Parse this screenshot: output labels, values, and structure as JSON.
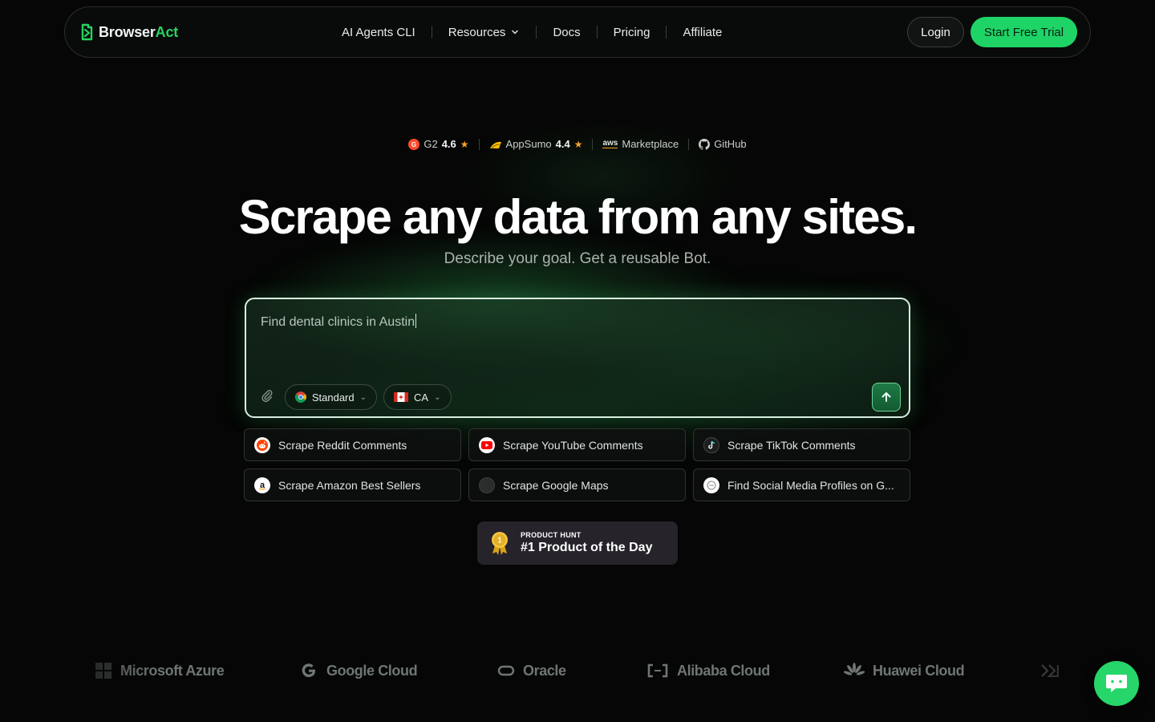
{
  "nav": {
    "logo_part1": "Browser",
    "logo_part2": "Act",
    "items": [
      {
        "label": "AI Agents CLI"
      },
      {
        "label": "Resources"
      },
      {
        "label": "Docs"
      },
      {
        "label": "Pricing"
      },
      {
        "label": "Affiliate"
      }
    ],
    "login_label": "Login",
    "trial_label": "Start Free Trial"
  },
  "ratings": {
    "g2_label": "G2",
    "g2_score": "4.6",
    "appsumo_label": "AppSumo",
    "appsumo_score": "4.4",
    "aws_label": "Marketplace",
    "aws_mark": "aws",
    "github_label": "GitHub"
  },
  "hero": {
    "title": "Scrape any data from any sites.",
    "subtitle": "Describe your goal. Get a reusable Bot."
  },
  "prompt": {
    "value": "Find dental clinics in Austin",
    "mode_label": "Standard",
    "region_label": "CA"
  },
  "suggestions": [
    {
      "label": "Scrape Reddit Comments",
      "icon": "reddit-icon"
    },
    {
      "label": "Scrape YouTube Comments",
      "icon": "youtube-icon"
    },
    {
      "label": "Scrape TikTok Comments",
      "icon": "tiktok-icon"
    },
    {
      "label": "Scrape Amazon Best Sellers",
      "icon": "amazon-icon"
    },
    {
      "label": "Scrape Google Maps",
      "icon": "google-maps-icon"
    },
    {
      "label": "Find Social Media Profiles on G...",
      "icon": "social-icon"
    }
  ],
  "product_hunt": {
    "small": "PRODUCT HUNT",
    "big": "#1 Product of the Day",
    "medal": "1"
  },
  "logos": [
    {
      "label": "Microsoft Azure"
    },
    {
      "label": "Google Cloud"
    },
    {
      "label": "Oracle"
    },
    {
      "label": "Alibaba Cloud"
    },
    {
      "label": "Huawei Cloud"
    }
  ],
  "colors": {
    "accent": "#1fd467",
    "background": "#050605"
  }
}
